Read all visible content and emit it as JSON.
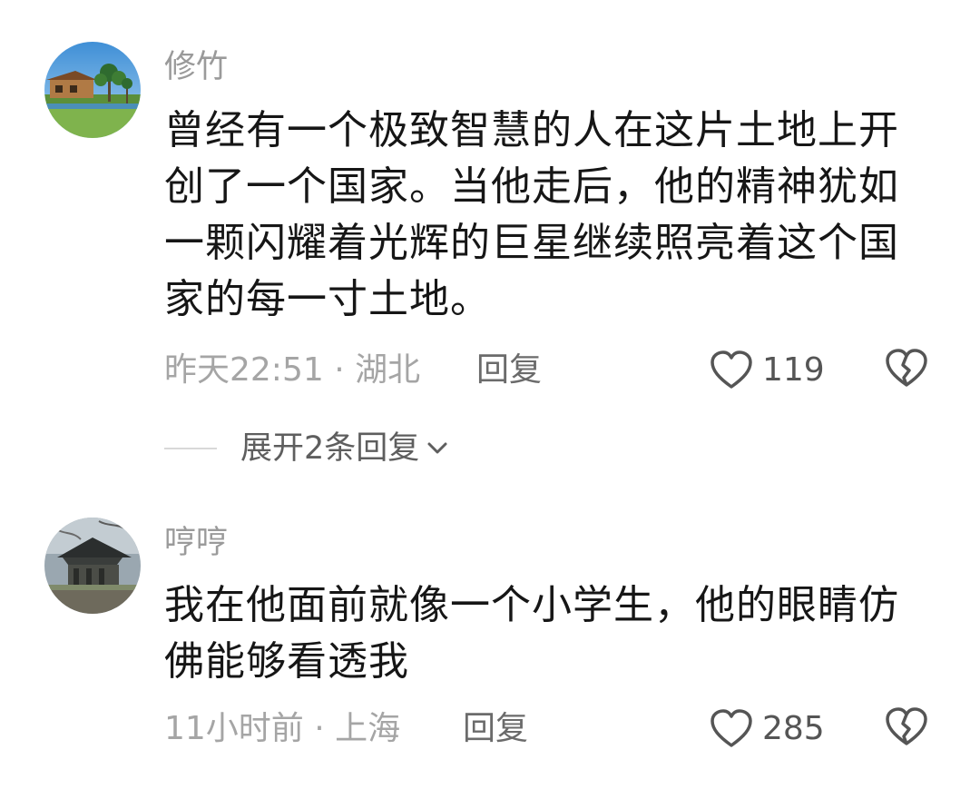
{
  "comments": [
    {
      "username": "修竹",
      "text": "曾经有一个极致智慧的人在这片土地上开创了一个国家。当他走后，他的精神犹如一颗闪耀着光辉的巨星继续照亮着这个国家的每一寸土地。",
      "time_location": "昨天22:51 · 湖北",
      "reply_label": "回复",
      "likes": "119",
      "avatar_icon": "beach-house-photo-icon",
      "expand_label": "展开2条回复"
    },
    {
      "username": "哼哼",
      "text": "我在他面前就像一个小学生，他的眼睛仿佛能够看透我",
      "time_location": "11小时前 · 上海",
      "reply_label": "回复",
      "likes": "285",
      "avatar_icon": "temple-photo-icon"
    }
  ],
  "icons": {
    "like": "heart-outline-icon",
    "dislike": "broken-heart-icon",
    "expand": "chevron-down-icon"
  },
  "colors": {
    "username": "#9a9a9a",
    "text": "#161616",
    "meta": "#a5a5a5",
    "reply": "#6b6b6b"
  }
}
